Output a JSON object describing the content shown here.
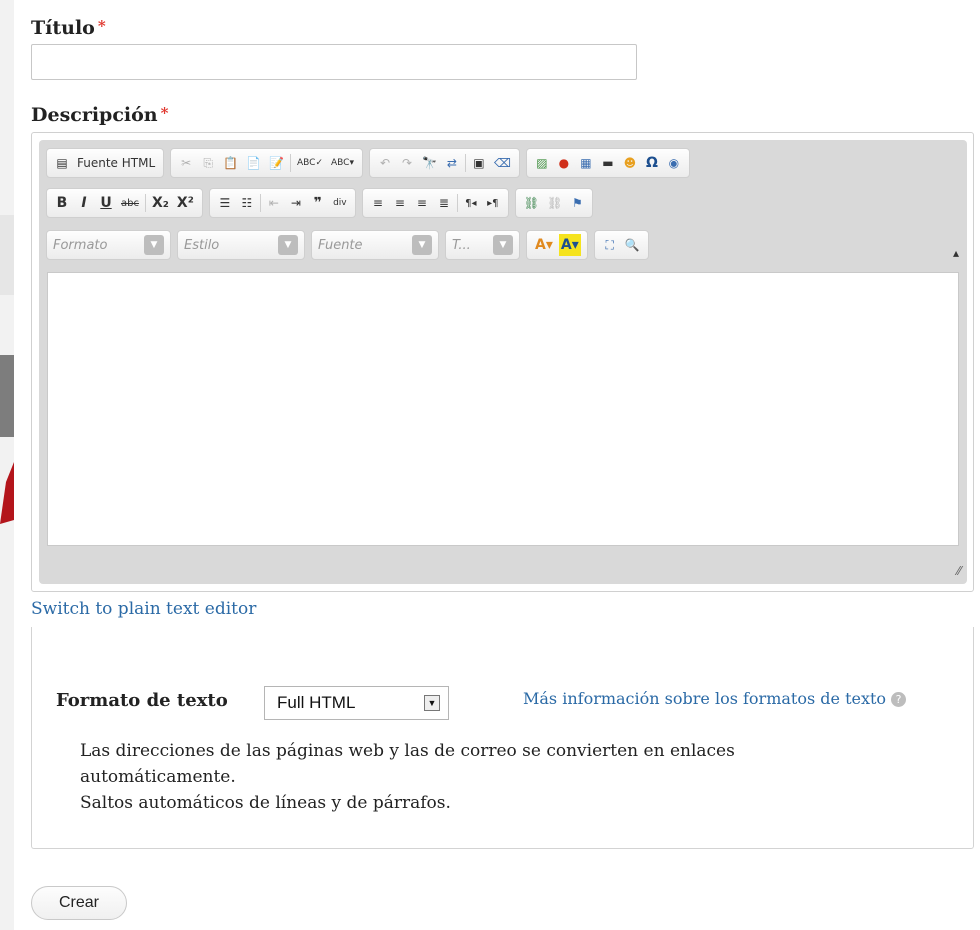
{
  "title_field": {
    "label": "Título",
    "required_mark": "*",
    "value": ""
  },
  "description_field": {
    "label": "Descripción",
    "required_mark": "*"
  },
  "toolbar": {
    "source_label": "Fuente HTML",
    "format_combo": "Formato",
    "style_combo": "Estilo",
    "font_combo": "Fuente",
    "size_combo": "T...",
    "bold": "B",
    "italic": "I",
    "underline": "U",
    "strike": "abc",
    "subscript": "X₂",
    "superscript": "X²"
  },
  "switch_link": "Switch to plain text editor",
  "text_format": {
    "label": "Formato de texto",
    "selected": "Full HTML",
    "more_info": "Más información sobre los formatos de texto",
    "tips": [
      "Las direcciones de las páginas web y las de correo se convierten en enlaces automáticamente.",
      "Saltos automáticos de líneas y de párrafos."
    ]
  },
  "actions": {
    "create": "Crear"
  },
  "colors": {
    "link": "#2b6aa6",
    "required": "#e0362d"
  }
}
